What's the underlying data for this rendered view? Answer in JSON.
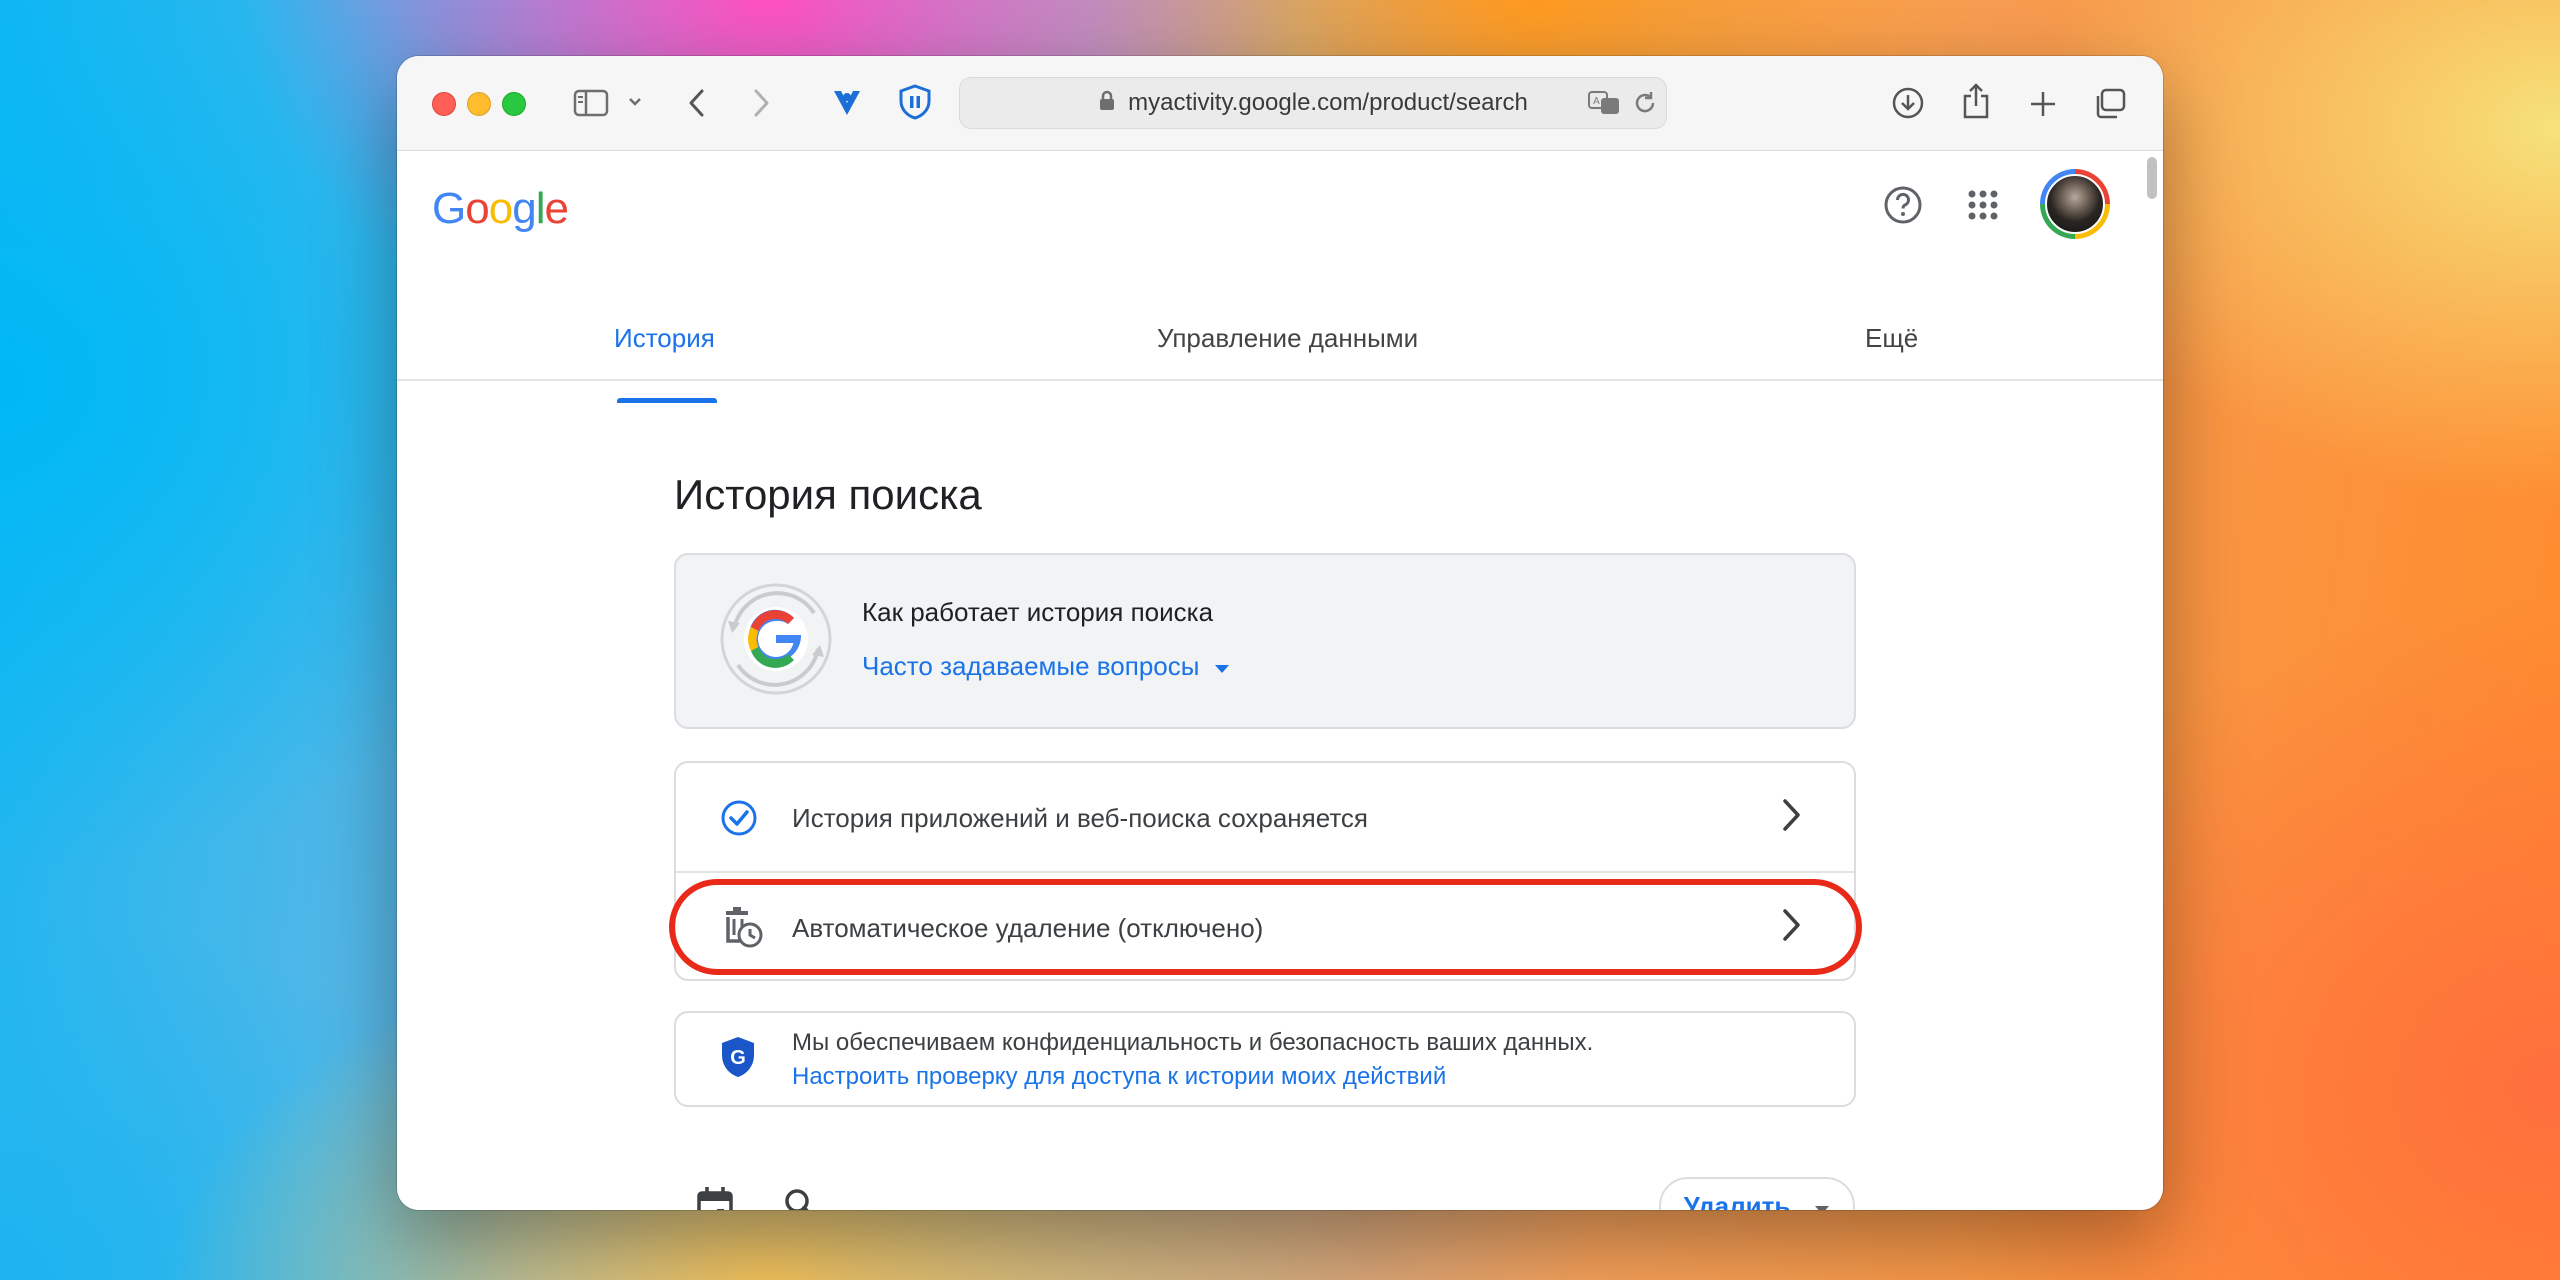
{
  "browser": {
    "url": "myactivity.google.com/product/search"
  },
  "header": {
    "logo": [
      {
        "ch": "G",
        "color": "#4285F4"
      },
      {
        "ch": "o",
        "color": "#EA4335"
      },
      {
        "ch": "o",
        "color": "#FBBC05"
      },
      {
        "ch": "g",
        "color": "#4285F4"
      },
      {
        "ch": "l",
        "color": "#34A853"
      },
      {
        "ch": "e",
        "color": "#EA4335"
      }
    ]
  },
  "tabs": {
    "history": "История",
    "data": "Управление данными",
    "more": "Ещё"
  },
  "page": {
    "title": "История поиска"
  },
  "info_card": {
    "title": "Как работает история поиска",
    "faq_link": "Часто задаваемые вопросы"
  },
  "settings": {
    "web_app_activity": "История приложений и веб-поиска сохраняется",
    "auto_delete": "Автоматическое удаление (отключено)"
  },
  "privacy": {
    "text": "Мы обеспечиваем конфиденциальность и безопасность ваших данных.",
    "link": "Настроить проверку для доступа к истории моих действий"
  },
  "actions": {
    "delete": "Удалить"
  },
  "colors": {
    "accent": "#1a73e8",
    "highlight": "#ea2a18"
  }
}
